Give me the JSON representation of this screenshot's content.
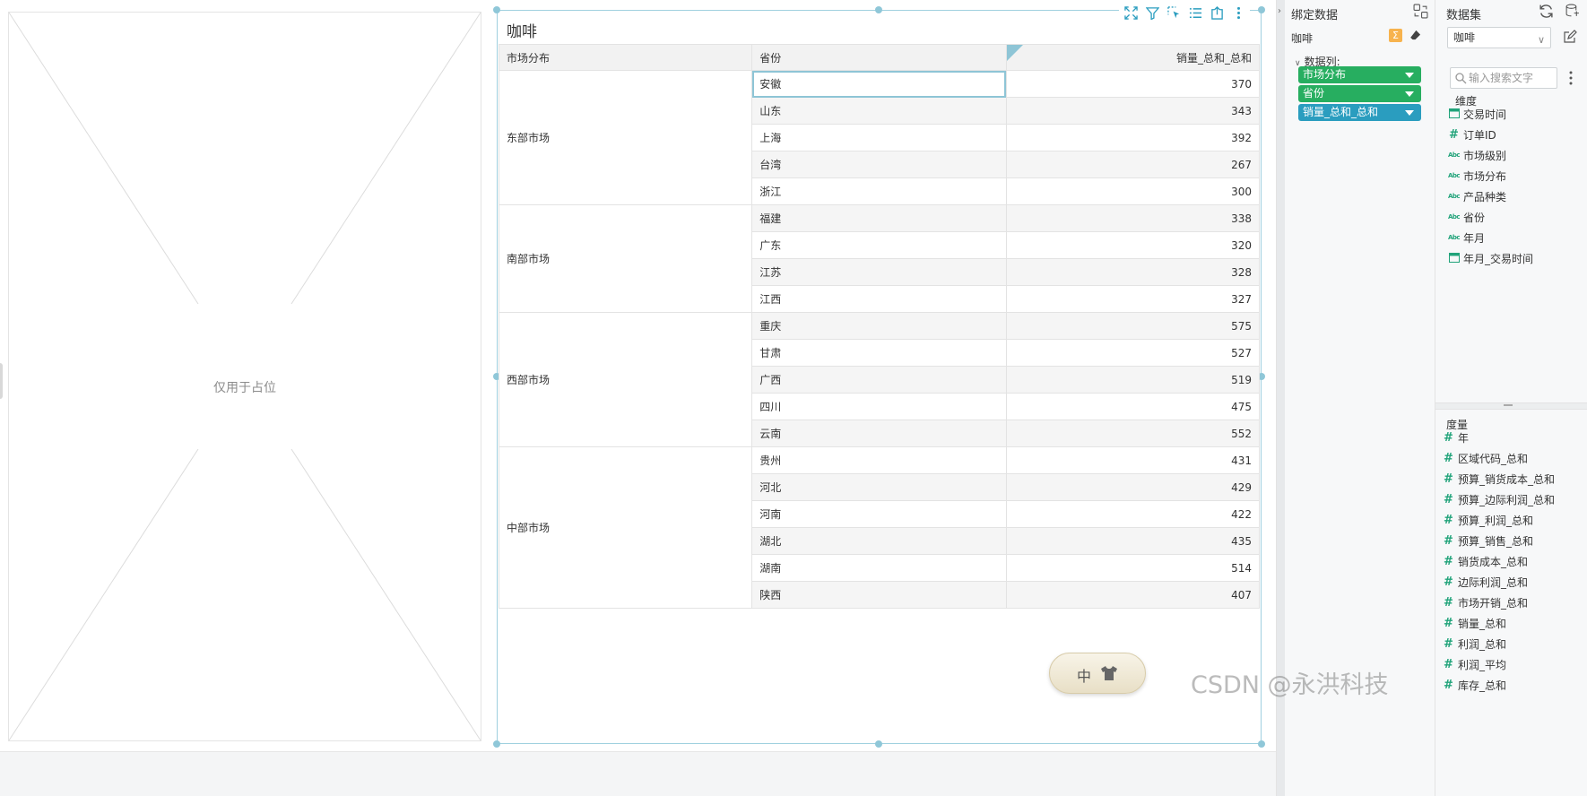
{
  "placeholder": {
    "label": "仅用于占位"
  },
  "widget": {
    "title": "咖啡",
    "toolbar": [
      "expand-icon",
      "filter-icon",
      "select-icon",
      "list-icon",
      "export-icon",
      "more-icon"
    ],
    "columns": [
      "市场分布",
      "省份",
      "销量_总和_总和"
    ],
    "groups": [
      {
        "market": "东部市场",
        "rows": [
          {
            "province": "安徽",
            "value": "370"
          },
          {
            "province": "山东",
            "value": "343"
          },
          {
            "province": "上海",
            "value": "392"
          },
          {
            "province": "台湾",
            "value": "267"
          },
          {
            "province": "浙江",
            "value": "300"
          }
        ]
      },
      {
        "market": "南部市场",
        "rows": [
          {
            "province": "福建",
            "value": "338"
          },
          {
            "province": "广东",
            "value": "320"
          },
          {
            "province": "江苏",
            "value": "328"
          },
          {
            "province": "江西",
            "value": "327"
          }
        ]
      },
      {
        "market": "西部市场",
        "rows": [
          {
            "province": "重庆",
            "value": "575"
          },
          {
            "province": "甘肃",
            "value": "527"
          },
          {
            "province": "广西",
            "value": "519"
          },
          {
            "province": "四川",
            "value": "475"
          },
          {
            "province": "云南",
            "value": "552"
          }
        ]
      },
      {
        "market": "中部市场",
        "rows": [
          {
            "province": "贵州",
            "value": "431"
          },
          {
            "province": "河北",
            "value": "429"
          },
          {
            "province": "河南",
            "value": "422"
          },
          {
            "province": "湖北",
            "value": "435"
          },
          {
            "province": "湖南",
            "value": "514"
          },
          {
            "province": "陕西",
            "value": "407"
          }
        ]
      }
    ]
  },
  "bind_panel": {
    "title": "绑定数据",
    "dataset": "咖啡",
    "sum_symbol": "Σ",
    "columns_label": "数据列:",
    "pills": [
      {
        "label": "市场分布",
        "color": "#27ae60"
      },
      {
        "label": "省份",
        "color": "#27ae60"
      },
      {
        "label": "销量_总和_总和",
        "color": "#2a9dbf"
      }
    ]
  },
  "dataset_panel": {
    "title": "数据集",
    "selected": "咖啡",
    "search_placeholder": "输入搜索文字",
    "dimensions_title": "维度",
    "dimensions": [
      {
        "icon": "calendar-icon",
        "label": "交易时间"
      },
      {
        "icon": "hash-icon",
        "label": "订单ID"
      },
      {
        "icon": "abc-icon",
        "label": "市场级别"
      },
      {
        "icon": "abc-icon",
        "label": "市场分布"
      },
      {
        "icon": "abc-icon",
        "label": "产品种类"
      },
      {
        "icon": "abc-icon",
        "label": "省份"
      },
      {
        "icon": "abc-icon",
        "label": "年月"
      },
      {
        "icon": "calendar-icon",
        "label": "年月_交易时间"
      }
    ],
    "measures_title": "度量",
    "measures": [
      "年",
      "区域代码_总和",
      "预算_销货成本_总和",
      "预算_边际利润_总和",
      "预算_利润_总和",
      "预算_销售_总和",
      "销货成本_总和",
      "边际利润_总和",
      "市场开销_总和",
      "销量_总和",
      "利润_总和",
      "利润_平均",
      "库存_总和"
    ]
  },
  "ime": {
    "label": "中"
  },
  "watermark": "CSDN @永洪科技",
  "colors": {
    "accent": "#2a9dbf",
    "green": "#27ae60",
    "selection": "#8ec5d6"
  }
}
